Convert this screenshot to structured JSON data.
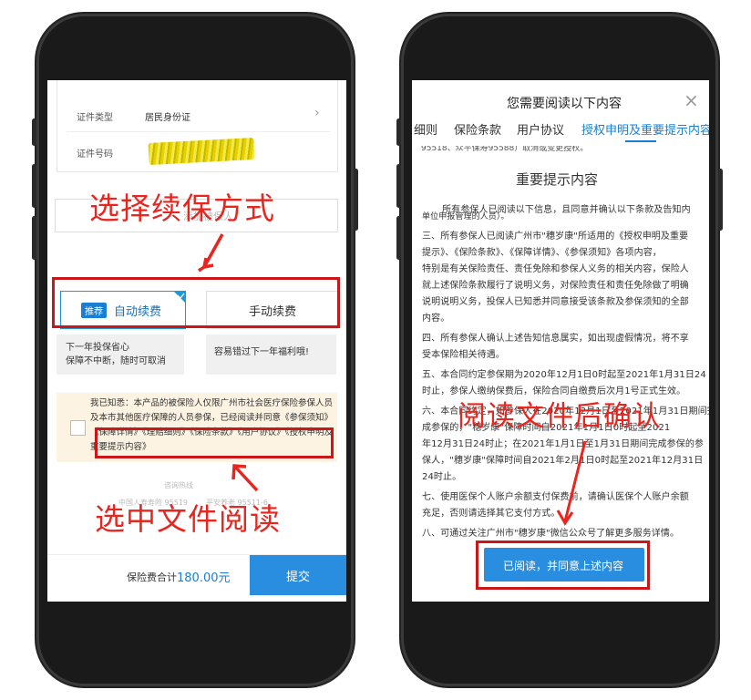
{
  "left_phone": {
    "id_type_label": "证件类型",
    "id_type_value": "居民身份证",
    "id_number_label": "证件号码",
    "field_hint": "添加被保人",
    "annotation_top": "选择续保方式",
    "auto_badge": "推荐",
    "auto_label": "自动续费",
    "manual_label": "手动续费",
    "auto_desc_1": "下一年投保省心",
    "auto_desc_2": "保障不中断，随时可取消",
    "manual_desc": "容易错过下一年福利哦!",
    "notice_text": "我已知悉：本产品的被保险人仅限广州市社会医疗保险参保人员及本市其他医疗保障的人员参保，已经阅读并同意《参保须知》《保障详情》《理赔细则》《保险条款》《用户协议》《授权申明及重要提示内容》",
    "hotline_title": "咨询热线",
    "hotline_1": "中国人寿寿险 95519",
    "hotline_2": "平安养老 95511-6",
    "annotation_bottom": "选中文件阅读",
    "total_label": "保险费合计",
    "total_value": "180.00元",
    "submit_label": "提交"
  },
  "right_phone": {
    "modal_title": "您需要阅读以下内容",
    "tabs": [
      "细则",
      "保险条款",
      "用户协议",
      "授权申明及重要提示内容"
    ],
    "active_tab": 3,
    "truncated_top": "95518、众平保寿95588）取消或变更授权。",
    "section_title": "重要提示内容",
    "lines": [
      "所有参保人已阅读以下信息，且同意并确认以下条款及告知内",
      "单位申报管理的人员）。",
      "三、所有参保人已阅读广州市\"穗岁康\"所适用的《授权申明及重要",
      "提示》、《保险条款》、《保障详情》、《参保须知》各项内容，",
      "特别是有关保险责任、责任免除和参保人义务的相关内容，保险人",
      "就上述保险条款履行了说明义务，对保险责任和责任免除做了明确",
      "说明说明义务，投保人已知悉并同意接受该条款及参保须知的全部",
      "内容。",
      "四、所有参保人确认上述告知信息属实，如出现虚假情况，将不享",
      "受本保险相关待遇。",
      "五、本合同约定参保期为2020年12月1日0时起至2021年1月31日24",
      "时止，参保人缴纳保费后，保险合同自缴费后次月1号正式生效。",
      "六、本合同约定，如参保人在2020年12月1日至2021年1月31日期间完",
      "成参保的，\"穗岁康\"保障时间自2021年1月1日0时起至2021",
      "年12月31日24时止；在2021年1月1日至1月31日期间完成参保的参",
      "保人，\"穗岁康\"保障时间自2021年2月1日0时起至2021年12月31日",
      "24时止。",
      "七、使用医保个人账户余额支付保费前，请确认医保个人账户余额",
      "充足，否则请选择其它支付方式。",
      "八、可通过关注广州市\"穗岁康\"微信公众号了解更多服务详情。"
    ],
    "annotation": "阅读文件后确认",
    "confirm_label": "已阅读，并同意上述内容"
  }
}
